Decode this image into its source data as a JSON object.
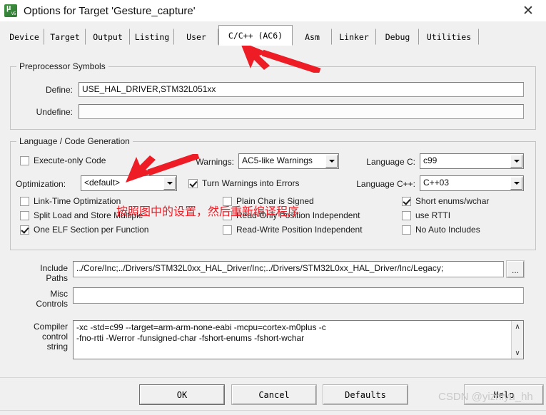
{
  "window": {
    "title": "Options for Target 'Gesture_capture'",
    "icon": "uvision-icon",
    "close_label": "✕"
  },
  "tabs": [
    {
      "label": "Device",
      "selected": false
    },
    {
      "label": "Target",
      "selected": false
    },
    {
      "label": "Output",
      "selected": false
    },
    {
      "label": "Listing",
      "selected": false
    },
    {
      "label": "User",
      "selected": false
    },
    {
      "label": "C/C++ (AC6)",
      "selected": true
    },
    {
      "label": "Asm",
      "selected": false
    },
    {
      "label": "Linker",
      "selected": false
    },
    {
      "label": "Debug",
      "selected": false
    },
    {
      "label": "Utilities",
      "selected": false
    }
  ],
  "preprocessor": {
    "group_title": "Preprocessor Symbols",
    "define_label": "Define:",
    "define_value": "USE_HAL_DRIVER,STM32L051xx",
    "undefine_label": "Undefine:",
    "undefine_value": ""
  },
  "language": {
    "group_title": "Language / Code Generation",
    "execute_only_code": {
      "label": "Execute-only Code",
      "checked": false
    },
    "optimization_label": "Optimization:",
    "optimization_value": "<default>",
    "link_time_optimization": {
      "label": "Link-Time Optimization",
      "checked": false
    },
    "split_load_store": {
      "label": "Split Load and Store Multiple",
      "checked": false
    },
    "one_elf_section": {
      "label": "One ELF Section per Function",
      "checked": true
    },
    "warnings_label": "Warnings:",
    "warnings_value": "AC5-like Warnings",
    "turn_warnings_into_errors": {
      "label": "Turn Warnings into Errors",
      "checked": true
    },
    "plain_char_signed": {
      "label": "Plain Char is Signed",
      "checked": false
    },
    "read_only_position_independent": {
      "label": "Read-Only Position Independent",
      "checked": false
    },
    "read_write_position_independent": {
      "label": "Read-Write Position Independent",
      "checked": false
    },
    "language_c_label": "Language C:",
    "language_c_value": "c99",
    "language_cpp_label": "Language C++:",
    "language_cpp_value": "C++03",
    "short_enums_wchar": {
      "label": "Short enums/wchar",
      "checked": true
    },
    "use_rtti": {
      "label": "use RTTI",
      "checked": false
    },
    "no_auto_includes": {
      "label": "No Auto Includes",
      "checked": false
    }
  },
  "paths": {
    "include_label_line1": "Include",
    "include_label_line2": "Paths",
    "include_value": "../Core/Inc;../Drivers/STM32L0xx_HAL_Driver/Inc;../Drivers/STM32L0xx_HAL_Driver/Inc/Legacy;",
    "browse_label": "...",
    "misc_label_line1": "Misc",
    "misc_label_line2": "Controls",
    "misc_value": ""
  },
  "compiler": {
    "label_line1": "Compiler",
    "label_line2": "control",
    "label_line3": "string",
    "line1": "-xc -std=c99 --target=arm-arm-none-eabi -mcpu=cortex-m0plus -c",
    "line2": "-fno-rtti -Werror -funsigned-char -fshort-enums -fshort-wchar",
    "scroll_up": "∧",
    "scroll_down": "∨"
  },
  "buttons": {
    "ok": "OK",
    "cancel": "Cancel",
    "defaults": "Defaults",
    "help": "Help"
  },
  "annotations": {
    "note_cn": "按照图中的设置，然后重新编译程序",
    "watermark": "CSDN @yizhiyu_hh",
    "arrow_color": "#ee1c25"
  }
}
